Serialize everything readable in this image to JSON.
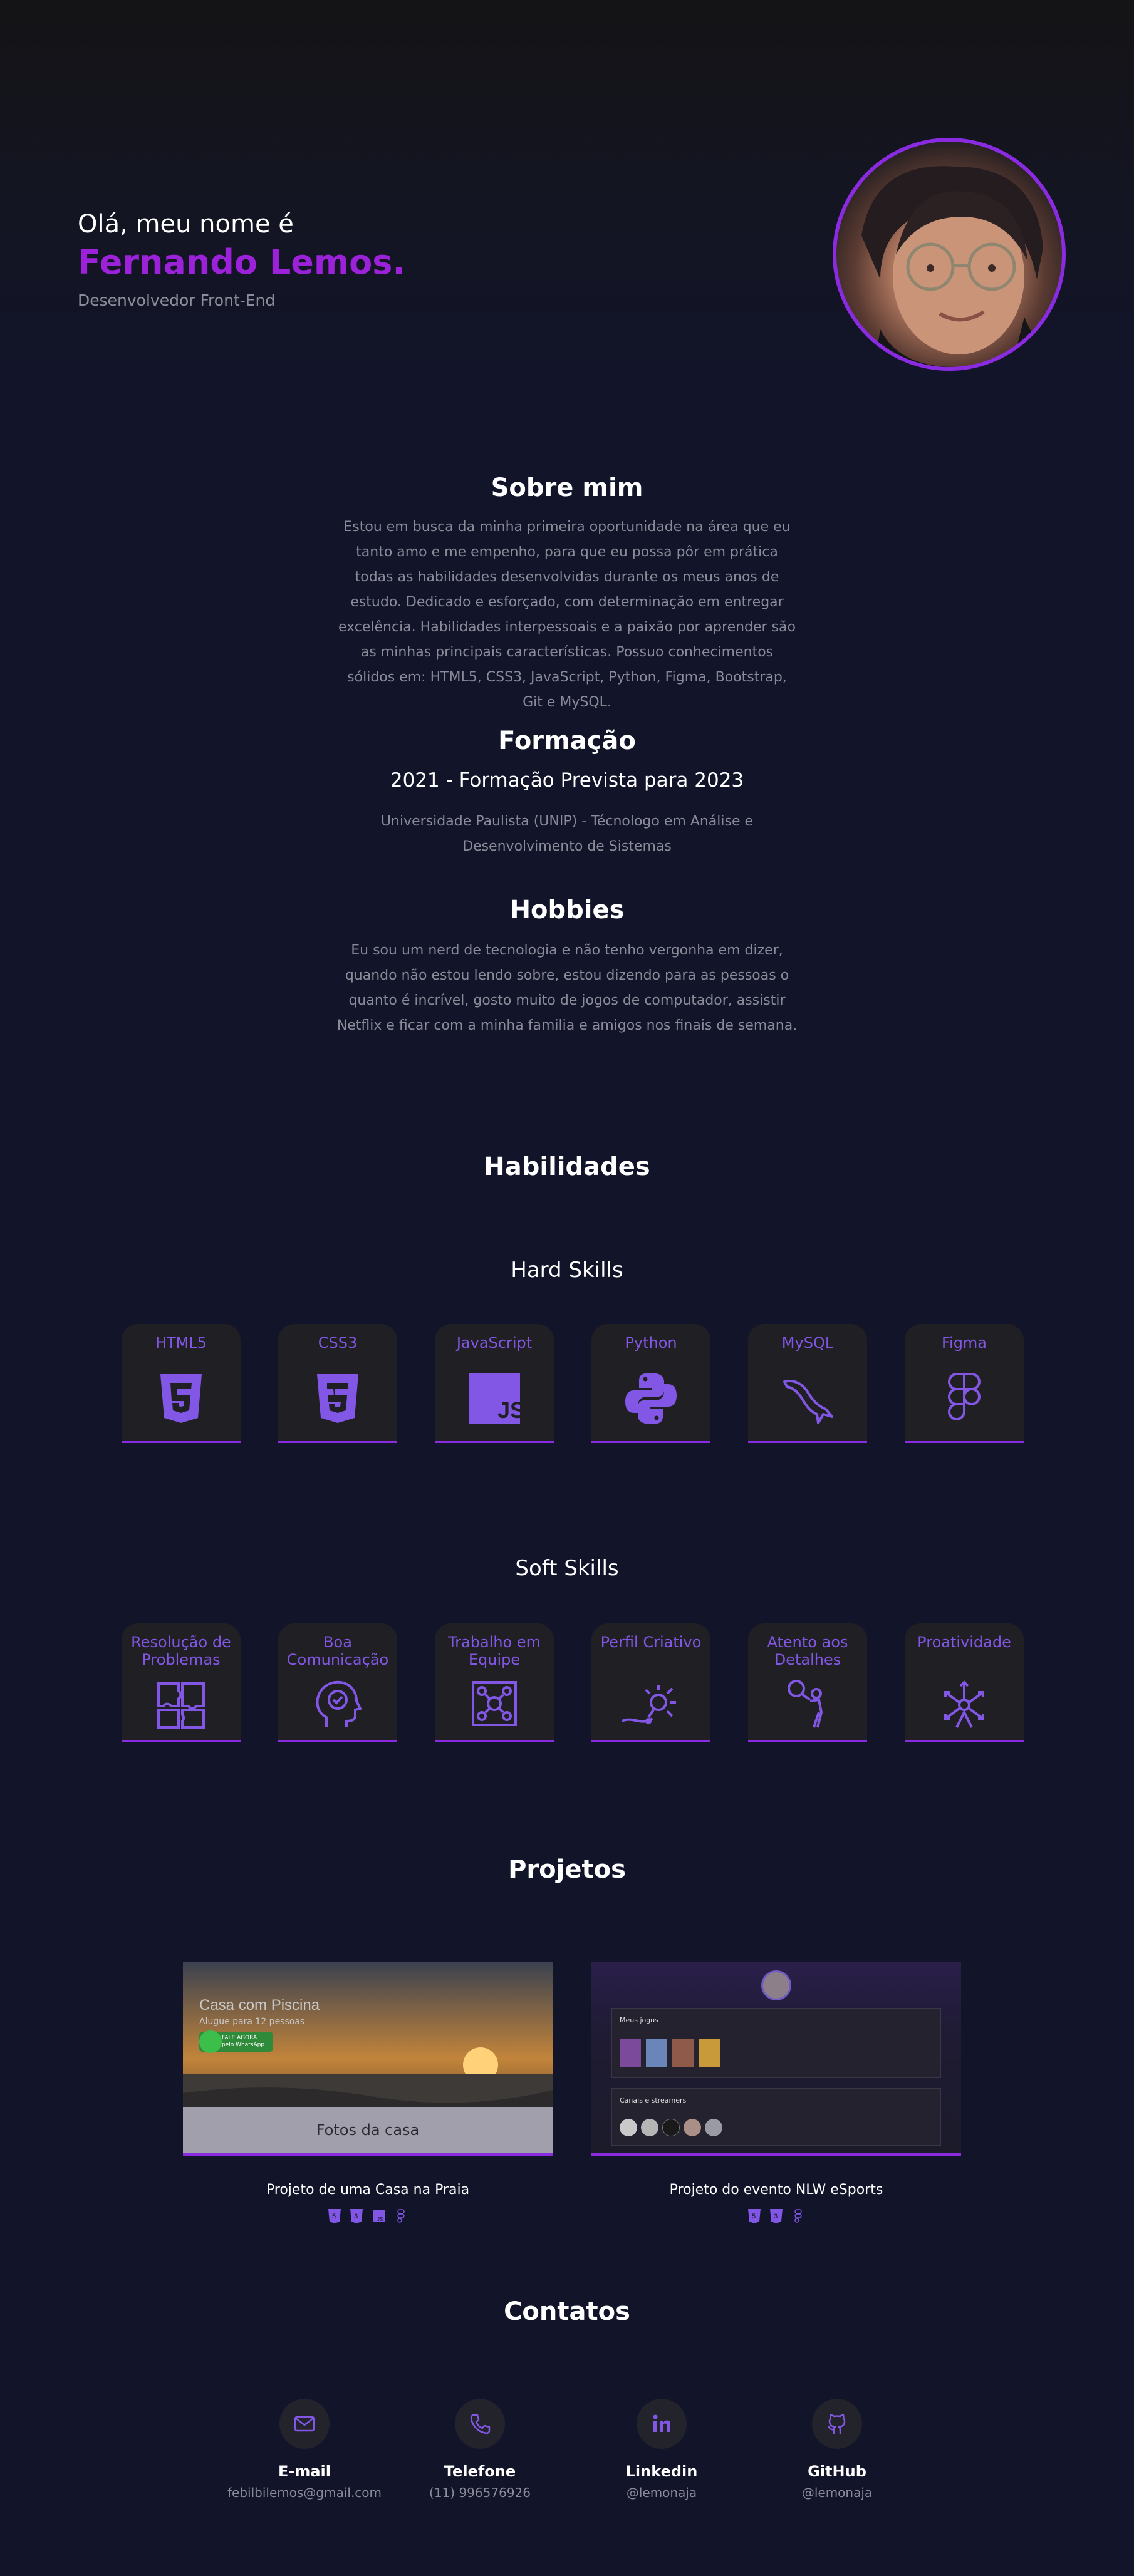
{
  "hero": {
    "greeting": "Olá, meu nome é",
    "name": "Fernando Lemos.",
    "role": "Desenvolvedor Front-End",
    "photo": "profile-photo"
  },
  "about": {
    "title": "Sobre mim",
    "text": "Estou em busca da minha primeira oportunidade na área que eu tanto amo e me empenho, para que eu possa pôr em prática todas as habilidades desenvolvidas durante os meus anos de estudo. Dedicado e esforçado, com determinação em entregar excelência. Habilidades interpessoais e a paixão por aprender são as minhas principais características. Possuo conhecimentos sólidos em: HTML5, CSS3, JavaScript, Python, Figma, Bootstrap, Git e MySQL."
  },
  "education": {
    "title": "Formação",
    "period": "2021 - Formação Prevista para 2023",
    "text": "Universidade Paulista (UNIP) - Técnologo em Análise e Desenvolvimento de Sistemas"
  },
  "hobbies": {
    "title": "Hobbies",
    "text": "Eu sou um nerd de tecnologia e não tenho vergonha em dizer, quando não estou lendo sobre, estou dizendo para as pessoas o quanto é incrível, gosto muito de jogos de computador, assistir Netflix e ficar com a minha familia e amigos nos finais de semana."
  },
  "skills": {
    "title": "Habilidades",
    "hard_title": "Hard Skills",
    "hard": [
      {
        "label": "HTML5",
        "icon": "html5-icon"
      },
      {
        "label": "CSS3",
        "icon": "css3-icon"
      },
      {
        "label": "JavaScript",
        "icon": "javascript-icon"
      },
      {
        "label": "Python",
        "icon": "python-icon"
      },
      {
        "label": "MySQL",
        "icon": "mysql-dolphin-icon"
      },
      {
        "label": "Figma",
        "icon": "figma-icon"
      }
    ],
    "soft_title": "Soft Skills",
    "soft": [
      {
        "label": "Resolução de Problemas",
        "icon": "puzzle-icon"
      },
      {
        "label": "Boa Comunicação",
        "icon": "head-chat-icon"
      },
      {
        "label": "Trabalho em Equipe",
        "icon": "team-icon"
      },
      {
        "label": "Perfil Criativo",
        "icon": "creative-icon"
      },
      {
        "label": "Atento aos Detalhes",
        "icon": "magnifier-person-icon"
      },
      {
        "label": "Proatividade",
        "icon": "proactive-icon"
      }
    ]
  },
  "projects": {
    "title": "Projetos",
    "items": [
      {
        "title": "Projeto de uma Casa na Praia",
        "overlay": "Fotos da casa",
        "preview_heading": "Casa com Piscina",
        "preview_sub": "Alugue para 12 pessoas",
        "preview_badge": "FALE AGORA pelo WhatsApp",
        "techs": [
          "html5-icon",
          "css3-icon",
          "javascript-icon",
          "figma-icon"
        ]
      },
      {
        "title": "Projeto do evento NLW eSports",
        "preview_section_1": "Meus jogos",
        "preview_section_2": "Canais e streamers",
        "techs": [
          "html5-icon",
          "css3-icon",
          "figma-icon"
        ]
      }
    ]
  },
  "contacts": {
    "title": "Contatos",
    "items": [
      {
        "label": "E-mail",
        "value": "febilbilemos@gmail.com",
        "icon": "mail-icon"
      },
      {
        "label": "Telefone",
        "value": "(11) 996576926",
        "icon": "phone-icon"
      },
      {
        "label": "Linkedin",
        "value": "@lemonaja",
        "icon": "linkedin-icon"
      },
      {
        "label": "GitHub",
        "value": "@lemonaja",
        "icon": "github-icon"
      }
    ]
  },
  "colors": {
    "background": "#12142a",
    "accent": "#8a2be2",
    "name": "#9b22d8",
    "skill_label": "#8257e5",
    "card": "#202024",
    "muted_text": "#8a8a98"
  }
}
